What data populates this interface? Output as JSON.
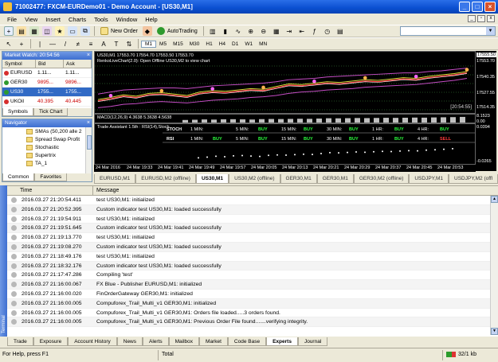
{
  "window": {
    "title": "71002477: FXCM-EURDemo01 - Demo Account - [US30,M1]"
  },
  "menu": [
    "File",
    "View",
    "Insert",
    "Charts",
    "Tools",
    "Window",
    "Help"
  ],
  "toolbar": {
    "new_order": "New Order",
    "autotrading": "AutoTrading",
    "timeframes": [
      "M1",
      "M5",
      "M15",
      "M30",
      "H1",
      "H4",
      "D1",
      "W1",
      "MN"
    ],
    "active_timeframe": "M1"
  },
  "market_watch": {
    "title": "Market Watch: 20:54:56",
    "columns": [
      "Symbol",
      "Bid",
      "Ask"
    ],
    "rows": [
      {
        "symbol": "EURUSD",
        "bid": "1.11...",
        "ask": "1.11...",
        "color": "#d62e2e"
      },
      {
        "symbol": "GER30",
        "bid": "9895...",
        "ask": "9896...",
        "color": "#2e9a2e"
      },
      {
        "symbol": "US30",
        "bid": "1755...",
        "ask": "1755...",
        "color": "#2e9a2e"
      },
      {
        "symbol": "UKOil",
        "bid": "40.395",
        "ask": "40.445",
        "color": "#d62e2e"
      }
    ],
    "tabs": [
      "Symbols",
      "Tick Chart"
    ]
  },
  "navigator": {
    "title": "Navigator",
    "items": [
      "SMAs (50,200 alle 2",
      "Spread Swap Profit",
      "Stochastic",
      "Supertrix",
      "TA_1"
    ],
    "tabs": [
      "Common",
      "Favorites"
    ]
  },
  "chart": {
    "header": "US30,M1  17553.70 17554.70 17553.50 17553.70",
    "subheader": "RenkoLiveChart(2.0): Open Offline US30,M2 to view chart",
    "price_labels": [
      "17555.50",
      "17553.70",
      "17540.35",
      "17527.55",
      "17514.35"
    ],
    "countdown": "[20:54:55]",
    "macd_label": "MACD(12,26,9) 4.3638 5.3638 4.5638",
    "macd_scale": [
      "8.1523",
      "0.00"
    ],
    "ind_label": "Trade Assistant 1.5th : RSI(14),Stoch",
    "ind_scale": [
      "0.0394",
      "-0.0265"
    ],
    "ind_rows": [
      {
        "label": "STOCH",
        "tf": [
          "1 MIN:",
          "5 MIN:",
          "15 MIN:",
          "30 MIN:",
          "1 HR:",
          "4 HR:"
        ],
        "signal": [
          "",
          "BUY",
          "BUY",
          "BUY",
          "BUY",
          "BUY"
        ]
      },
      {
        "label": "RSI",
        "tf": [
          "1 MIN:",
          "5 MIN:",
          "15 MIN:",
          "30 MIN:",
          "1 HR:",
          "4 HR:"
        ],
        "signal": [
          "BUY",
          "BUY",
          "BUY",
          "BUY",
          "BUY",
          "SELL"
        ]
      }
    ],
    "time_labels": [
      "24 Mar 2016",
      "24 Mar 19:33",
      "24 Mar 19:41",
      "24 Mar 19:49",
      "24 Mar 19:57",
      "24 Mar 20:05",
      "24 Mar 20:13",
      "24 Mar 20:21",
      "24 Mar 20:29",
      "24 Mar 20:37",
      "24 Mar 20:45",
      "24 Mar 20:53"
    ],
    "series": {
      "price": [
        17512,
        17515,
        17519,
        17517,
        17521,
        17522,
        17520,
        17518,
        17523,
        17525,
        17524,
        17526,
        17528,
        17527,
        17531,
        17535,
        17534,
        17536,
        17538,
        17537,
        17539,
        17541,
        17540,
        17542,
        17544,
        17543,
        17546,
        17548,
        17550,
        17553
      ],
      "upper": [
        17522,
        17525,
        17528,
        17529,
        17530,
        17531,
        17531,
        17530,
        17532,
        17534,
        17535,
        17536,
        17537,
        17538,
        17540,
        17543,
        17544,
        17545,
        17547,
        17548,
        17549,
        17550,
        17551,
        17552,
        17553,
        17553,
        17555,
        17556,
        17558,
        17560
      ],
      "lower": [
        17502,
        17504,
        17507,
        17508,
        17510,
        17511,
        17510,
        17509,
        17511,
        17513,
        17514,
        17515,
        17517,
        17518,
        17520,
        17523,
        17525,
        17526,
        17528,
        17529,
        17530,
        17532,
        17533,
        17534,
        17535,
        17536,
        17538,
        17540,
        17542,
        17545
      ]
    }
  },
  "chart_tabs": [
    "EURUSD,M1",
    "EURUSD,M2 (offline)",
    "US30,M1",
    "US30,M2 (offline)",
    "GER30,M1",
    "GER30,M1",
    "GER30,M2 (offline)",
    "USDJPY,M1",
    "USDJPY,M2 (offl"
  ],
  "active_chart_tab": 2,
  "terminal": {
    "side_label": "Terminal",
    "columns": [
      "Time",
      "Message"
    ],
    "rows": [
      {
        "time": "2016.03.27 21:20:54.411",
        "msg": "test US30,M1: initialized"
      },
      {
        "time": "2016.03.27 21:20:52.395",
        "msg": "Custom indicator test US30,M1: loaded successfully"
      },
      {
        "time": "2016.03.27 21:19:54.911",
        "msg": "test US30,M1: initialized"
      },
      {
        "time": "2016.03.27 21:19:51.645",
        "msg": "Custom indicator test US30,M1: loaded successfully"
      },
      {
        "time": "2016.03.27 21:19:13.770",
        "msg": "test US30,M1: initialized"
      },
      {
        "time": "2016.03.27 21:19:08.270",
        "msg": "Custom indicator test US30,M1: loaded successfully"
      },
      {
        "time": "2016.03.27 21:18:49.176",
        "msg": "test US30,M1: initialized"
      },
      {
        "time": "2016.03.27 21:18:32.176",
        "msg": "Custom indicator test US30,M1: loaded successfully"
      },
      {
        "time": "2016.03.27 21:17:47.286",
        "msg": "Compiling 'test'"
      },
      {
        "time": "2016.03.27 21:16:00.067",
        "msg": "FX Blue - Publisher EURUSD,M1: initialized"
      },
      {
        "time": "2016.03.27 21:16:00.020",
        "msg": "FinOrderGateway GER30,M1: initialized"
      },
      {
        "time": "2016.03.27 21:16:00.005",
        "msg": "Compuforex_Trail_Multi_v1 GER30,M1: initialized"
      },
      {
        "time": "2016.03.27 21:16:00.005",
        "msg": "Compuforex_Trail_Multi_v1 GER30,M1: Orders file loaded.....3 orders found."
      },
      {
        "time": "2016.03.27 21:16:00.005",
        "msg": "Compuforex_Trail_Multi_v1 GER30,M1: Previous Order File found.......verifying integrity."
      }
    ],
    "tabs": [
      "Trade",
      "Exposure",
      "Account History",
      "News",
      "Alerts",
      "Mailbox",
      "Market",
      "Code Base",
      "Experts",
      "Journal"
    ],
    "active_tab": "Experts"
  },
  "status": {
    "help": "For Help, press F1",
    "total": "Total",
    "connection": "32/1 kb"
  }
}
